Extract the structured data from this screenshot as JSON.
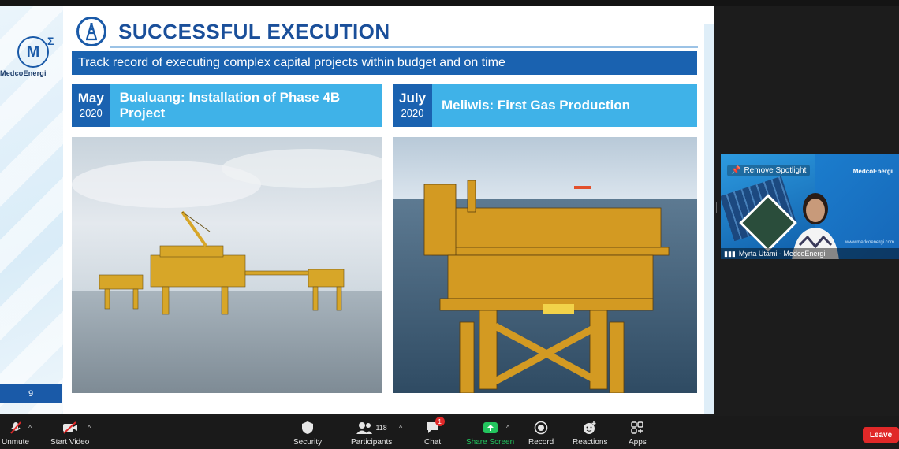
{
  "slide": {
    "brand_name": "MedcoEnergi",
    "brand_mark": "M",
    "brand_sigma": "Σ",
    "title": "SUCCESSFUL EXECUTION",
    "subtitle": "Track record of executing complex capital projects within budget and on time",
    "page_number": "9",
    "events": [
      {
        "month": "May",
        "year": "2020",
        "label": "Bualuang:  Installation of Phase 4B Project"
      },
      {
        "month": "July",
        "year": "2020",
        "label": "Meliwis: First Gas Production"
      }
    ],
    "colors": {
      "primary": "#1a62b0",
      "accent": "#3fb2e8",
      "title": "#1a4f9a"
    }
  },
  "video_tile": {
    "remove_spotlight": "Remove Spotlight",
    "brand": "MedcoEnergi",
    "participant_name": "Myrta Utami - MedcoEnergi",
    "website": "www.medcoenergi.com"
  },
  "toolbar": {
    "unmute": "Unmute",
    "start_video": "Start Video",
    "security": "Security",
    "participants": "Participants",
    "participants_count": "118",
    "chat": "Chat",
    "chat_badge": "1",
    "share_screen": "Share Screen",
    "record": "Record",
    "reactions": "Reactions",
    "apps": "Apps",
    "leave": "Leave"
  }
}
